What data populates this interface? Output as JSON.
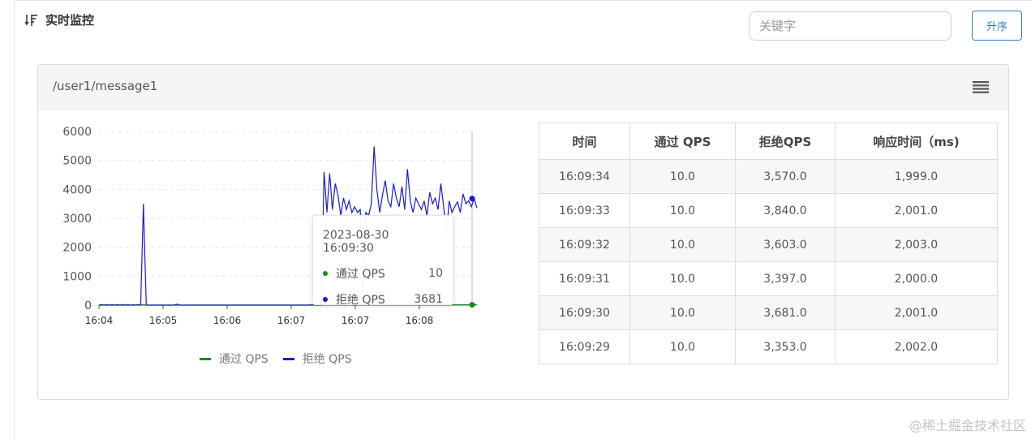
{
  "header": {
    "title": "实时监控",
    "search_placeholder": "关键字",
    "sort_label": "升序"
  },
  "panel": {
    "resource": "/user1/message1"
  },
  "chart_data": {
    "type": "line",
    "x_ticks": [
      "16:04",
      "16:05",
      "16:06",
      "16:07",
      "16:07",
      "16:08"
    ],
    "y_ticks": [
      0,
      1000,
      2000,
      3000,
      4000,
      5000,
      6000
    ],
    "ylim": [
      0,
      6000
    ],
    "grid": true,
    "legend_position": "bottom",
    "series": [
      {
        "name": "通过 QPS",
        "color": "#1a8a1a",
        "values": [
          0,
          20,
          0,
          20,
          0,
          20,
          0,
          20,
          0,
          20,
          0,
          20,
          0,
          20,
          0,
          20,
          0,
          20,
          0,
          0,
          0,
          0,
          0,
          0,
          0,
          0,
          0,
          0,
          0,
          0,
          0,
          0,
          0,
          0,
          0,
          0,
          0,
          0,
          0,
          0,
          0,
          0,
          0,
          0,
          0,
          0,
          0,
          0,
          0,
          0,
          0,
          0,
          0,
          0,
          0,
          0,
          0,
          0,
          0,
          0,
          0,
          0,
          0,
          0,
          0,
          0,
          0,
          0,
          0,
          0,
          0,
          0,
          0,
          0,
          0,
          0,
          0,
          0,
          0,
          0,
          0,
          10,
          10,
          10,
          10,
          10,
          10,
          10,
          10,
          10,
          10,
          10,
          10,
          10,
          10,
          10,
          10,
          10,
          10,
          10,
          10,
          10,
          10,
          10,
          10,
          10,
          10,
          10,
          10,
          10,
          10,
          10,
          10,
          10,
          10,
          10,
          10,
          10,
          10,
          10,
          10,
          10,
          10,
          10,
          10,
          10,
          10,
          10,
          10,
          10,
          10,
          10,
          10,
          10,
          10,
          10,
          10,
          10,
          10,
          10,
          10,
          10,
          10,
          10,
          10,
          10
        ]
      },
      {
        "name": "拒绝 QPS",
        "color": "#1a1acc",
        "values": [
          0,
          0,
          0,
          0,
          0,
          0,
          0,
          0,
          0,
          0,
          0,
          0,
          0,
          0,
          0,
          0,
          3500,
          0,
          0,
          0,
          0,
          0,
          0,
          0,
          0,
          0,
          0,
          0,
          30,
          0,
          0,
          0,
          0,
          0,
          0,
          0,
          0,
          0,
          0,
          0,
          0,
          0,
          0,
          0,
          0,
          0,
          0,
          0,
          0,
          0,
          0,
          0,
          0,
          0,
          0,
          0,
          0,
          0,
          0,
          0,
          0,
          0,
          0,
          0,
          0,
          0,
          0,
          0,
          0,
          0,
          0,
          0,
          0,
          0,
          0,
          0,
          0,
          0,
          0,
          0,
          0,
          4600,
          3200,
          4550,
          3300,
          4200,
          3800,
          3100,
          3700,
          3300,
          3600,
          3200,
          3400,
          3200,
          3300,
          0,
          3200,
          3100,
          3500,
          5480,
          4000,
          3200,
          3800,
          4300,
          3600,
          3400,
          4200,
          3700,
          3400,
          4100,
          3300,
          4700,
          3600,
          3200,
          3700,
          3500,
          3300,
          3600,
          3100,
          3900,
          3500,
          3700,
          3300,
          4200,
          3400,
          2400,
          3600,
          3200,
          3400,
          3570,
          3200,
          3840,
          3500,
          3603,
          3397,
          3681,
          3353
        ]
      }
    ]
  },
  "tooltip": {
    "time": "2023-08-30 16:09:30",
    "rows": [
      {
        "name": "通过 QPS",
        "value": "10",
        "color": "#1a8a1a"
      },
      {
        "name": "拒绝 QPS",
        "value": "3681",
        "color": "#1a1acc"
      }
    ]
  },
  "table": {
    "headers": [
      "时间",
      "通过 QPS",
      "拒绝QPS",
      "响应时间（ms)"
    ],
    "rows": [
      [
        "16:09:34",
        "10.0",
        "3,570.0",
        "1,999.0"
      ],
      [
        "16:09:33",
        "10.0",
        "3,840.0",
        "2,001.0"
      ],
      [
        "16:09:32",
        "10.0",
        "3,603.0",
        "2,003.0"
      ],
      [
        "16:09:31",
        "10.0",
        "3,397.0",
        "2,000.0"
      ],
      [
        "16:09:30",
        "10.0",
        "3,681.0",
        "2,001.0"
      ],
      [
        "16:09:29",
        "10.0",
        "3,353.0",
        "2,002.0"
      ]
    ]
  },
  "watermark": "@稀土掘金技术社区"
}
